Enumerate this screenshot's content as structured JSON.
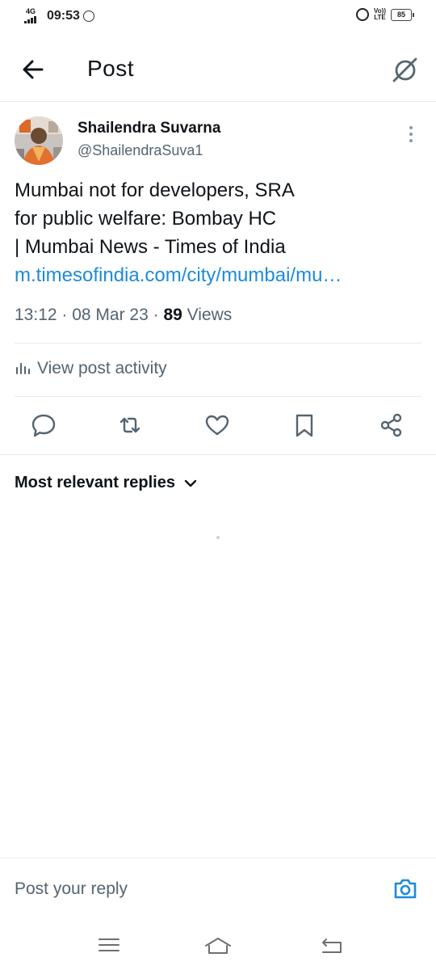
{
  "status_bar": {
    "network": "4G",
    "time": "09:53",
    "volte": [
      "Vo))",
      "LTE"
    ],
    "battery": "85"
  },
  "header": {
    "title": "Post"
  },
  "post": {
    "author_name": "Shailendra Suvarna",
    "author_handle": "@ShailendraSuva1",
    "text_lines": [
      "Mumbai not for developers, SRA",
      "for public welfare: Bombay HC",
      "| Mumbai News - Times of India"
    ],
    "link": "m.timesofindia.com/city/mumbai/mu…",
    "time": "13:12",
    "date": "08 Mar 23",
    "views_count": "89",
    "views_label": "Views",
    "activity_label": "View post activity"
  },
  "icons": {
    "back": "arrow-left-icon",
    "grok": "grok-icon",
    "more": "more-vertical-icon",
    "activity": "analytics-icon",
    "reply": "reply-icon",
    "repost": "repost-icon",
    "like": "heart-icon",
    "bookmark": "bookmark-icon",
    "share": "share-icon",
    "sort": "chevron-down-icon",
    "camera": "camera-icon"
  },
  "replies": {
    "sort_label": "Most relevant replies"
  },
  "composer": {
    "placeholder": "Post your reply"
  },
  "colors": {
    "link": "#1d8bd8",
    "secondary_text": "#536471",
    "primary_text": "#0f1419"
  }
}
